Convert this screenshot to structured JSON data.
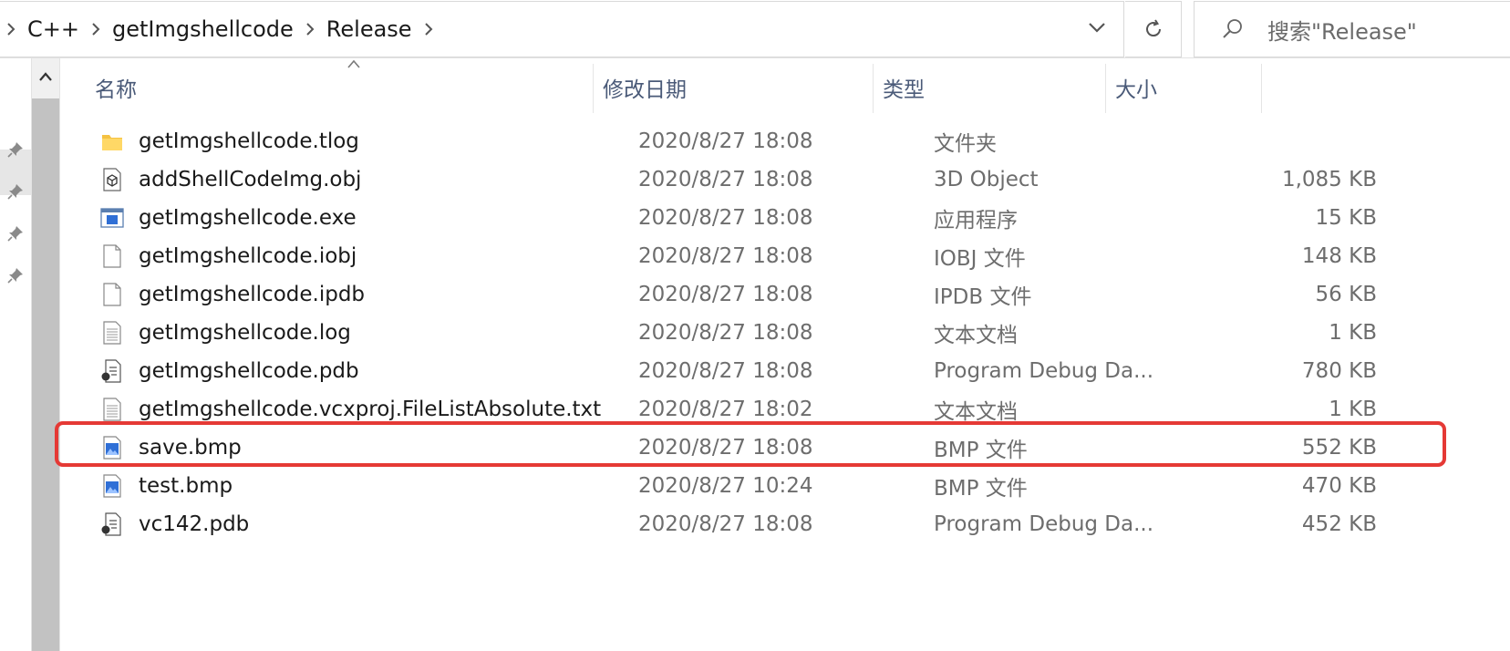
{
  "breadcrumb": {
    "items": [
      "C++",
      "getImgshellcode",
      "Release"
    ]
  },
  "search": {
    "placeholder": "搜索\"Release\""
  },
  "columns": {
    "name": "名称",
    "date": "修改日期",
    "type": "类型",
    "size": "大小"
  },
  "files": [
    {
      "name": "getImgshellcode.tlog",
      "date": "2020/8/27 18:08",
      "type": "文件夹",
      "size": "",
      "icon": "folder-icon"
    },
    {
      "name": "addShellCodeImg.obj",
      "date": "2020/8/27 18:08",
      "type": "3D Object",
      "size": "1,085 KB",
      "icon": "3d-object-icon"
    },
    {
      "name": "getImgshellcode.exe",
      "date": "2020/8/27 18:08",
      "type": "应用程序",
      "size": "15 KB",
      "icon": "application-icon"
    },
    {
      "name": "getImgshellcode.iobj",
      "date": "2020/8/27 18:08",
      "type": "IOBJ 文件",
      "size": "148 KB",
      "icon": "blank-file-icon"
    },
    {
      "name": "getImgshellcode.ipdb",
      "date": "2020/8/27 18:08",
      "type": "IPDB 文件",
      "size": "56 KB",
      "icon": "blank-file-icon"
    },
    {
      "name": "getImgshellcode.log",
      "date": "2020/8/27 18:08",
      "type": "文本文档",
      "size": "1 KB",
      "icon": "text-file-icon"
    },
    {
      "name": "getImgshellcode.pdb",
      "date": "2020/8/27 18:08",
      "type": "Program Debug Da...",
      "size": "780 KB",
      "icon": "pdb-file-icon"
    },
    {
      "name": "getImgshellcode.vcxproj.FileListAbsolute.txt",
      "date": "2020/8/27 18:02",
      "type": "文本文档",
      "size": "1 KB",
      "icon": "text-file-icon"
    },
    {
      "name": "save.bmp",
      "date": "2020/8/27 18:08",
      "type": "BMP 文件",
      "size": "552 KB",
      "icon": "bitmap-image-icon"
    },
    {
      "name": "test.bmp",
      "date": "2020/8/27 10:24",
      "type": "BMP 文件",
      "size": "470 KB",
      "icon": "bitmap-image-icon"
    },
    {
      "name": "vc142.pdb",
      "date": "2020/8/27 18:08",
      "type": "Program Debug Da...",
      "size": "452 KB",
      "icon": "pdb-file-icon"
    }
  ],
  "colors": {
    "highlight": "#e53935",
    "header_text": "#4a5a78",
    "folder": "#f5c242"
  }
}
